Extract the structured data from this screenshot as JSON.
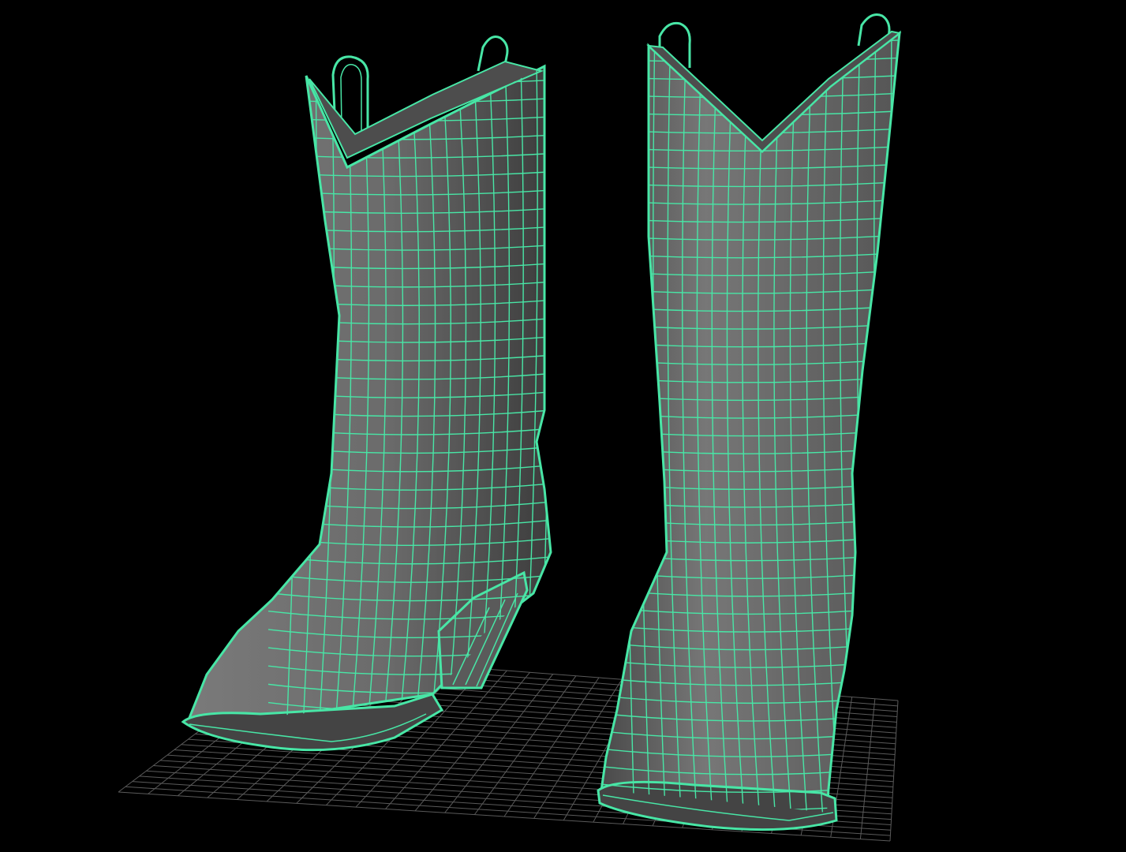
{
  "viewport": {
    "background_color": "#000000",
    "grid_color": "#5a5a5a",
    "mesh_shade_color": "#6a6a6a",
    "wireframe_color": "#48e6a6"
  },
  "scene": {
    "objects": [
      {
        "name": "cowboy-boot-left",
        "display": "shaded-wireframe",
        "selected": true
      },
      {
        "name": "cowboy-boot-right",
        "display": "shaded-wireframe",
        "selected": true
      }
    ],
    "ground_grid": true
  }
}
